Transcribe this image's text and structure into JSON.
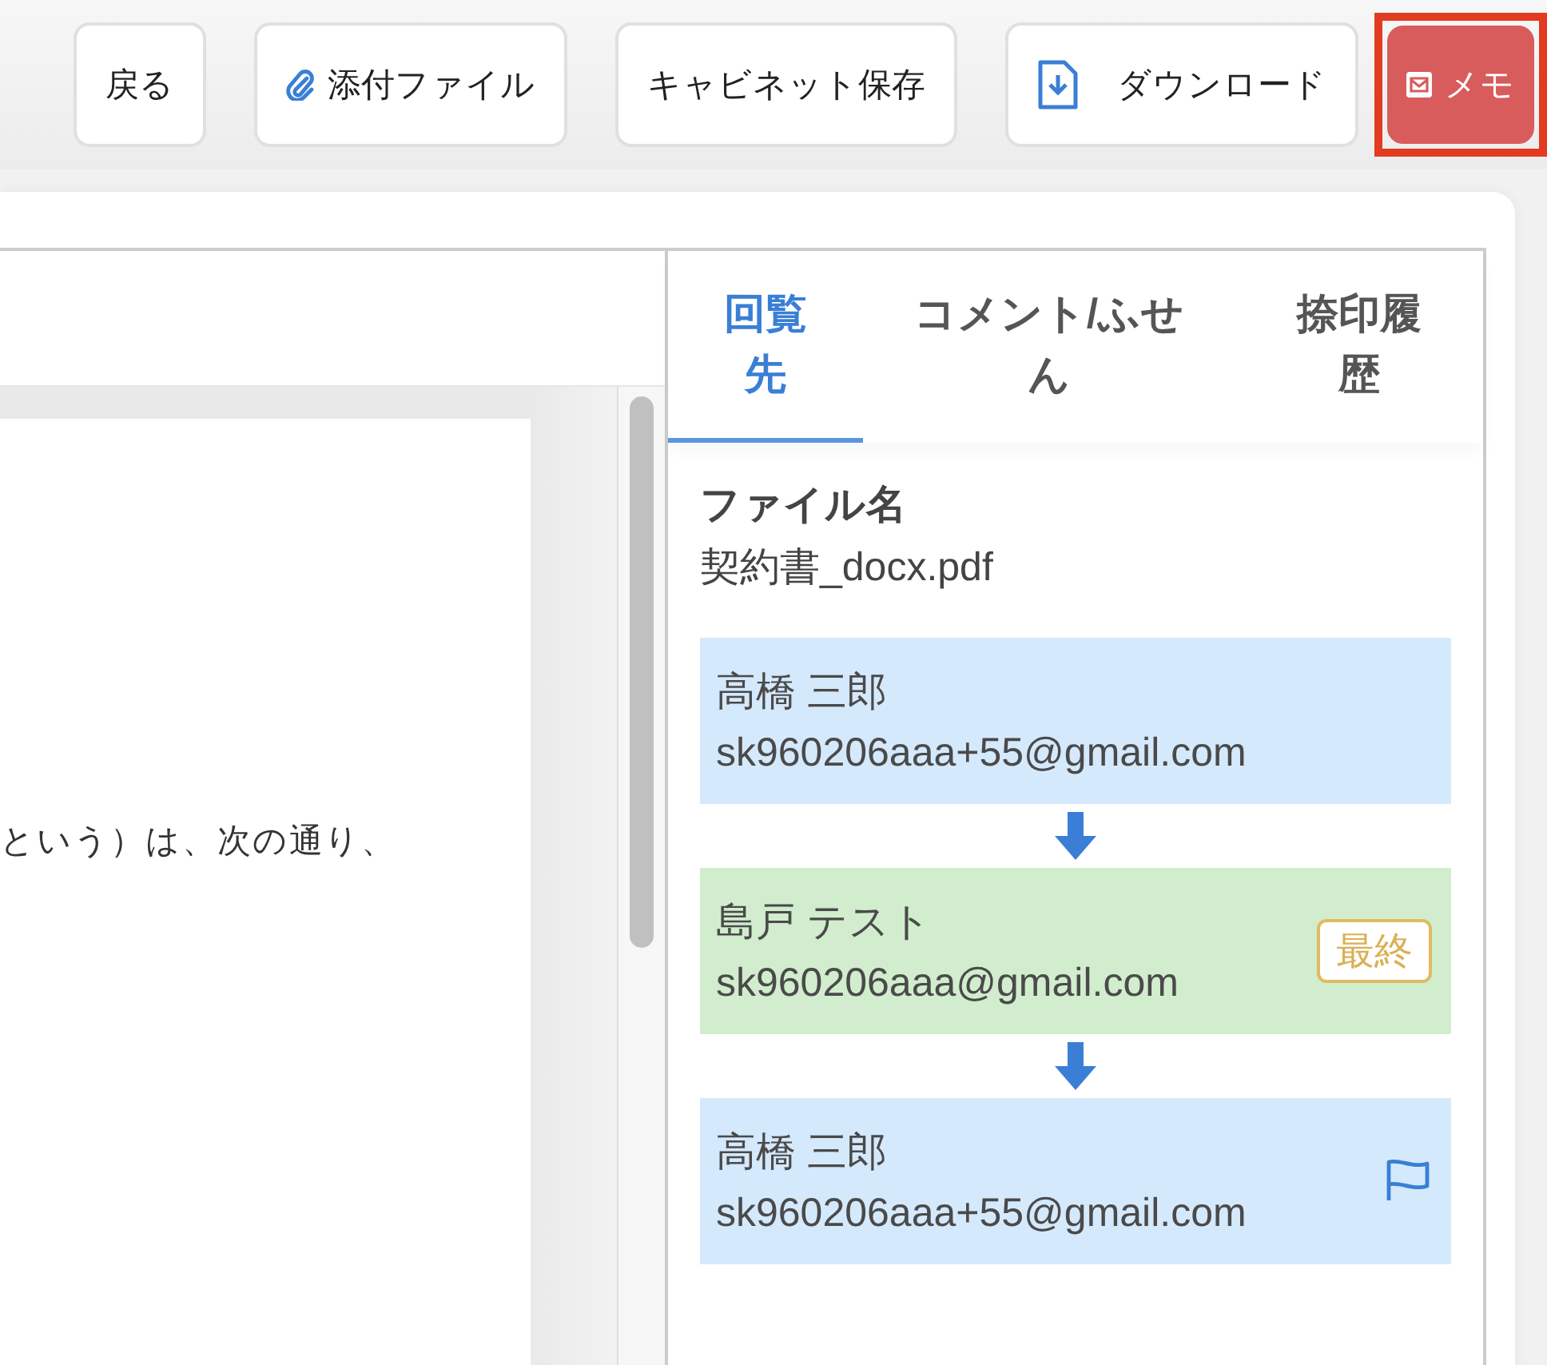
{
  "toolbar": {
    "buttons": [
      {
        "label": "戻る",
        "kind": "plain",
        "highlighted": false
      },
      {
        "label": "添付ファイル",
        "kind": "attach",
        "highlighted": false
      },
      {
        "label": "キャビネット保存",
        "kind": "plain",
        "highlighted": false
      },
      {
        "label": "ダウンロード",
        "kind": "download",
        "highlighted": false
      },
      {
        "label": "メモ",
        "kind": "memo",
        "highlighted": true
      }
    ]
  },
  "document": {
    "text": "という）は、次の通り、"
  },
  "side_panel": {
    "tabs": [
      {
        "label": "回覧先",
        "selected": true
      },
      {
        "label": "コメント/ふせん",
        "selected": false
      },
      {
        "label": "捺印履歴",
        "selected": false
      }
    ],
    "file_label": "ファイル名",
    "file_name": "契約書_docx.pdf",
    "recipients": [
      {
        "name": "高橋 三郎",
        "email": "sk960206aaa+55@gmail.com",
        "color": "#d5e9fc",
        "flagged": false
      },
      {
        "name": "島戸 テスト",
        "email": "sk960206aaa@gmail.com",
        "color": "#d1edcd",
        "badge": "最終",
        "flagged": false
      },
      {
        "name": "高橋 三郎",
        "email": "sk960206aaa+55@gmail.com",
        "color": "#d5e9fc",
        "flagged": true
      }
    ]
  }
}
